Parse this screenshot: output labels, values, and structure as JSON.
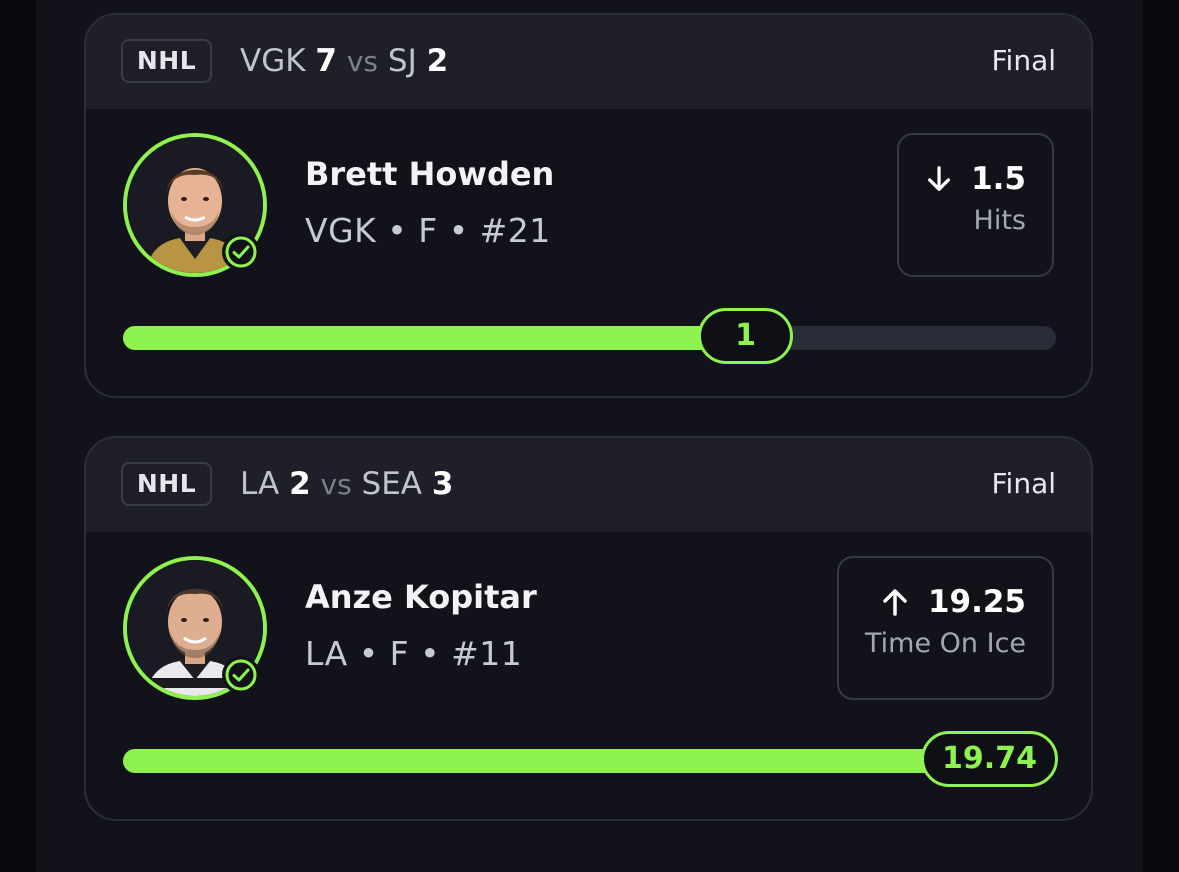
{
  "cards": [
    {
      "league": "NHL",
      "home_team": "VGK",
      "home_score": "7",
      "vs_label": "vs",
      "away_team": "SJ",
      "away_score": "2",
      "status": "Final",
      "player": {
        "name": "Brett Howden",
        "meta": "VGK • F • #21",
        "verified": true
      },
      "pick": {
        "direction": "under",
        "direction_icon": "arrow-down-icon",
        "line": "1.5",
        "stat": "Hits"
      },
      "progress": {
        "result": "1",
        "fill_fraction": 0.67
      },
      "colors": {
        "accent": "#8ef34e"
      }
    },
    {
      "league": "NHL",
      "home_team": "LA",
      "home_score": "2",
      "vs_label": "vs",
      "away_team": "SEA",
      "away_score": "3",
      "status": "Final",
      "player": {
        "name": "Anze Kopitar",
        "meta": "LA • F • #11",
        "verified": true
      },
      "pick": {
        "direction": "over",
        "direction_icon": "arrow-up-icon",
        "line": "19.25",
        "stat": "Time On Ice"
      },
      "progress": {
        "result": "19.74",
        "fill_fraction": 1.0
      },
      "colors": {
        "accent": "#8ef34e"
      }
    }
  ]
}
